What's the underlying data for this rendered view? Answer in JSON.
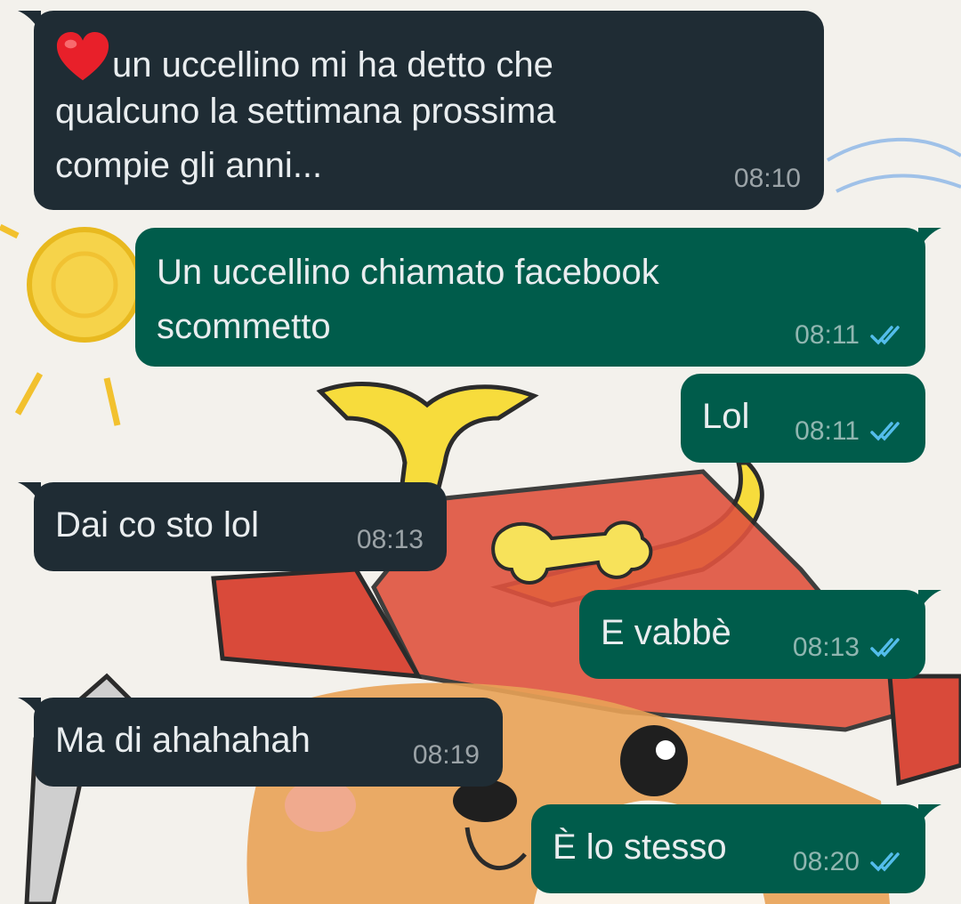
{
  "colors": {
    "incoming_bubble": "#1f2c34",
    "outgoing_bubble": "#005c4b",
    "read_ticks": "#53bdeb",
    "message_text": "#e9edef"
  },
  "messages": [
    {
      "direction": "incoming",
      "lines": [
        "un uccellino mi ha detto che",
        "qualcuno la settimana prossima",
        "compie gli anni..."
      ],
      "leading_icon": "red-heart-emoji",
      "time": "08:10"
    },
    {
      "direction": "outgoing",
      "lines": [
        "Un uccellino chiamato facebook",
        "scommetto"
      ],
      "time": "08:11",
      "status": "read"
    },
    {
      "direction": "outgoing",
      "text": "Lol",
      "time": "08:11",
      "status": "read"
    },
    {
      "direction": "incoming",
      "text": "Dai co sto lol",
      "time": "08:13"
    },
    {
      "direction": "outgoing",
      "text": "E vabbè",
      "time": "08:13",
      "status": "read"
    },
    {
      "direction": "incoming",
      "text": "Ma di ahahahah",
      "time": "08:19"
    },
    {
      "direction": "outgoing",
      "text": "È lo stesso",
      "time": "08:20",
      "status": "read"
    }
  ]
}
